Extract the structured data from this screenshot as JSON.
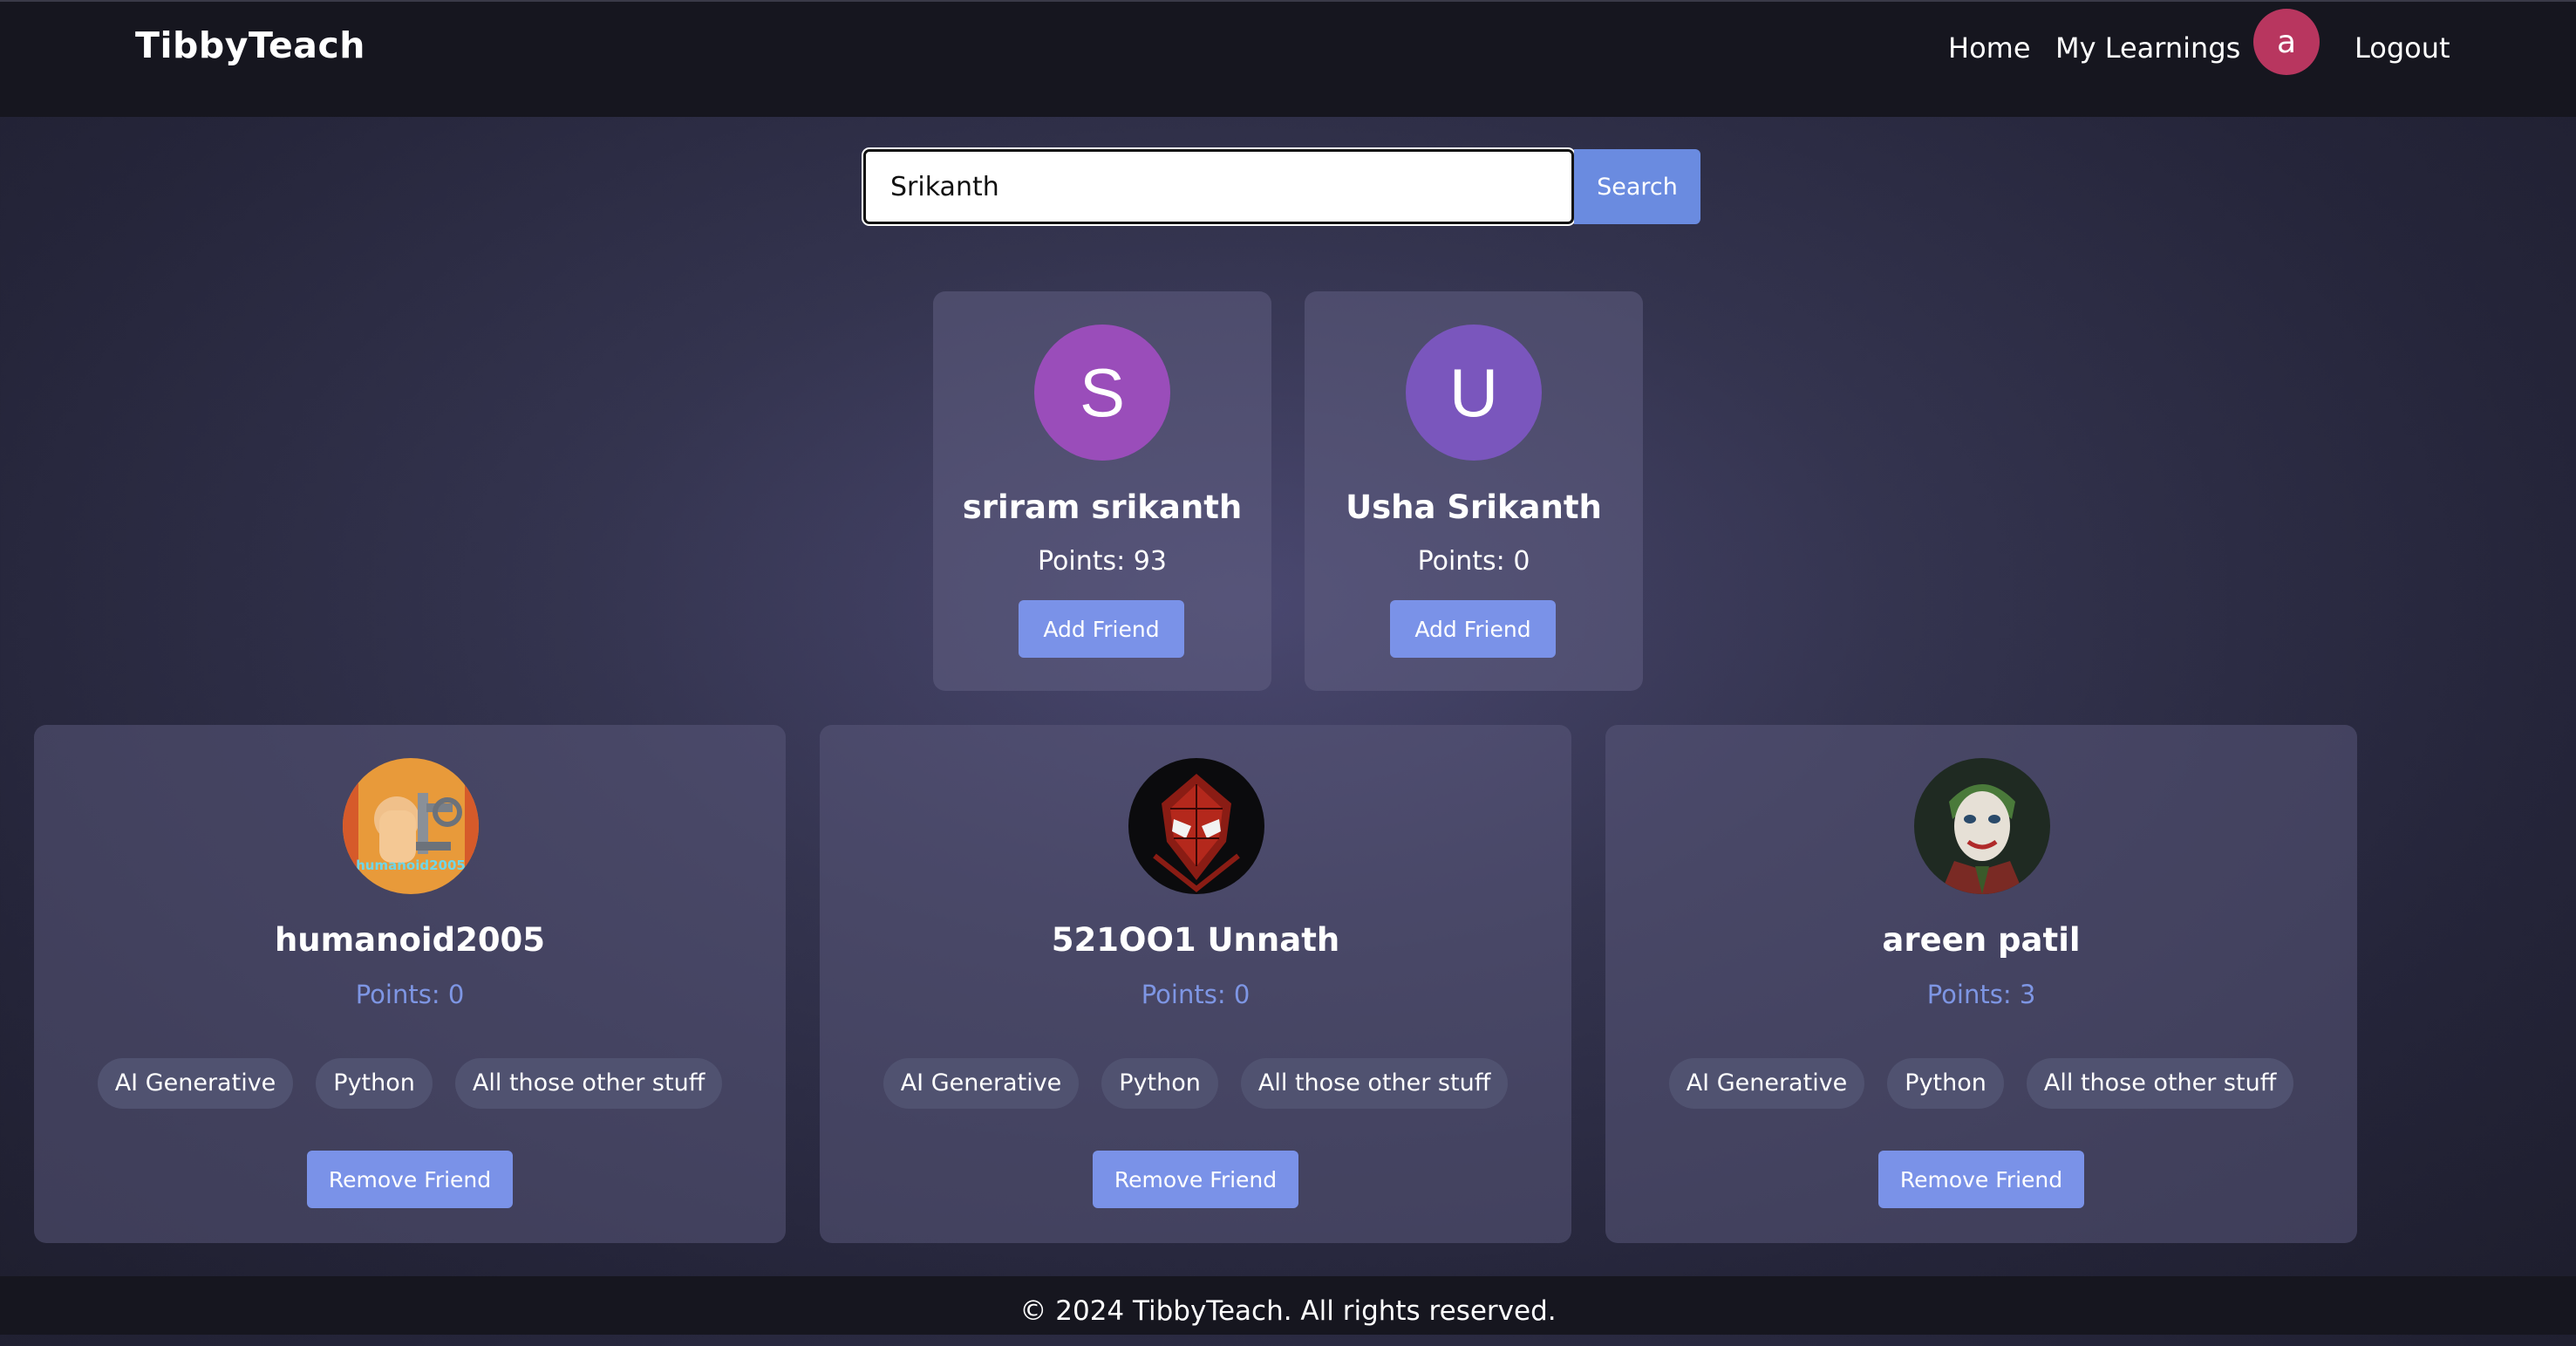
{
  "navbar": {
    "brand": "TibbyTeach",
    "links": {
      "home": "Home",
      "learnings": "My Learnings",
      "logout": "Logout"
    },
    "avatar_letter": "a",
    "avatar_color": "#b8365f"
  },
  "search": {
    "value": "Srikanth",
    "button_label": "Search"
  },
  "search_results": [
    {
      "initial": "S",
      "name": "sriram srikanth",
      "points": "Points: 93",
      "action": "Add Friend",
      "avatar_color": "#9a4dba"
    },
    {
      "initial": "U",
      "name": "Usha Srikanth",
      "points": "Points: 0",
      "action": "Add Friend",
      "avatar_color": "#7a56bd"
    }
  ],
  "friends": [
    {
      "name": "humanoid2005",
      "points": "Points: 0",
      "avatar_icon": "robot-arm-icon",
      "avatar_caption": "humanoid2005",
      "tags": [
        "AI Generative",
        "Python",
        "All those other stuff"
      ],
      "action": "Remove Friend"
    },
    {
      "name": "521OO1 Unnath",
      "points": "Points: 0",
      "avatar_icon": "spider-mask-icon",
      "tags": [
        "AI Generative",
        "Python",
        "All those other stuff"
      ],
      "action": "Remove Friend"
    },
    {
      "name": "areen patil",
      "points": "Points: 3",
      "avatar_icon": "joker-portrait-icon",
      "tags": [
        "AI Generative",
        "Python",
        "All those other stuff"
      ],
      "action": "Remove Friend"
    }
  ],
  "footer": {
    "text": "© 2024 TibbyTeach. All rights reserved."
  },
  "colors": {
    "accent": "#7a92e8",
    "points_text": "#7e96e4",
    "tag_bg": "#505270"
  }
}
